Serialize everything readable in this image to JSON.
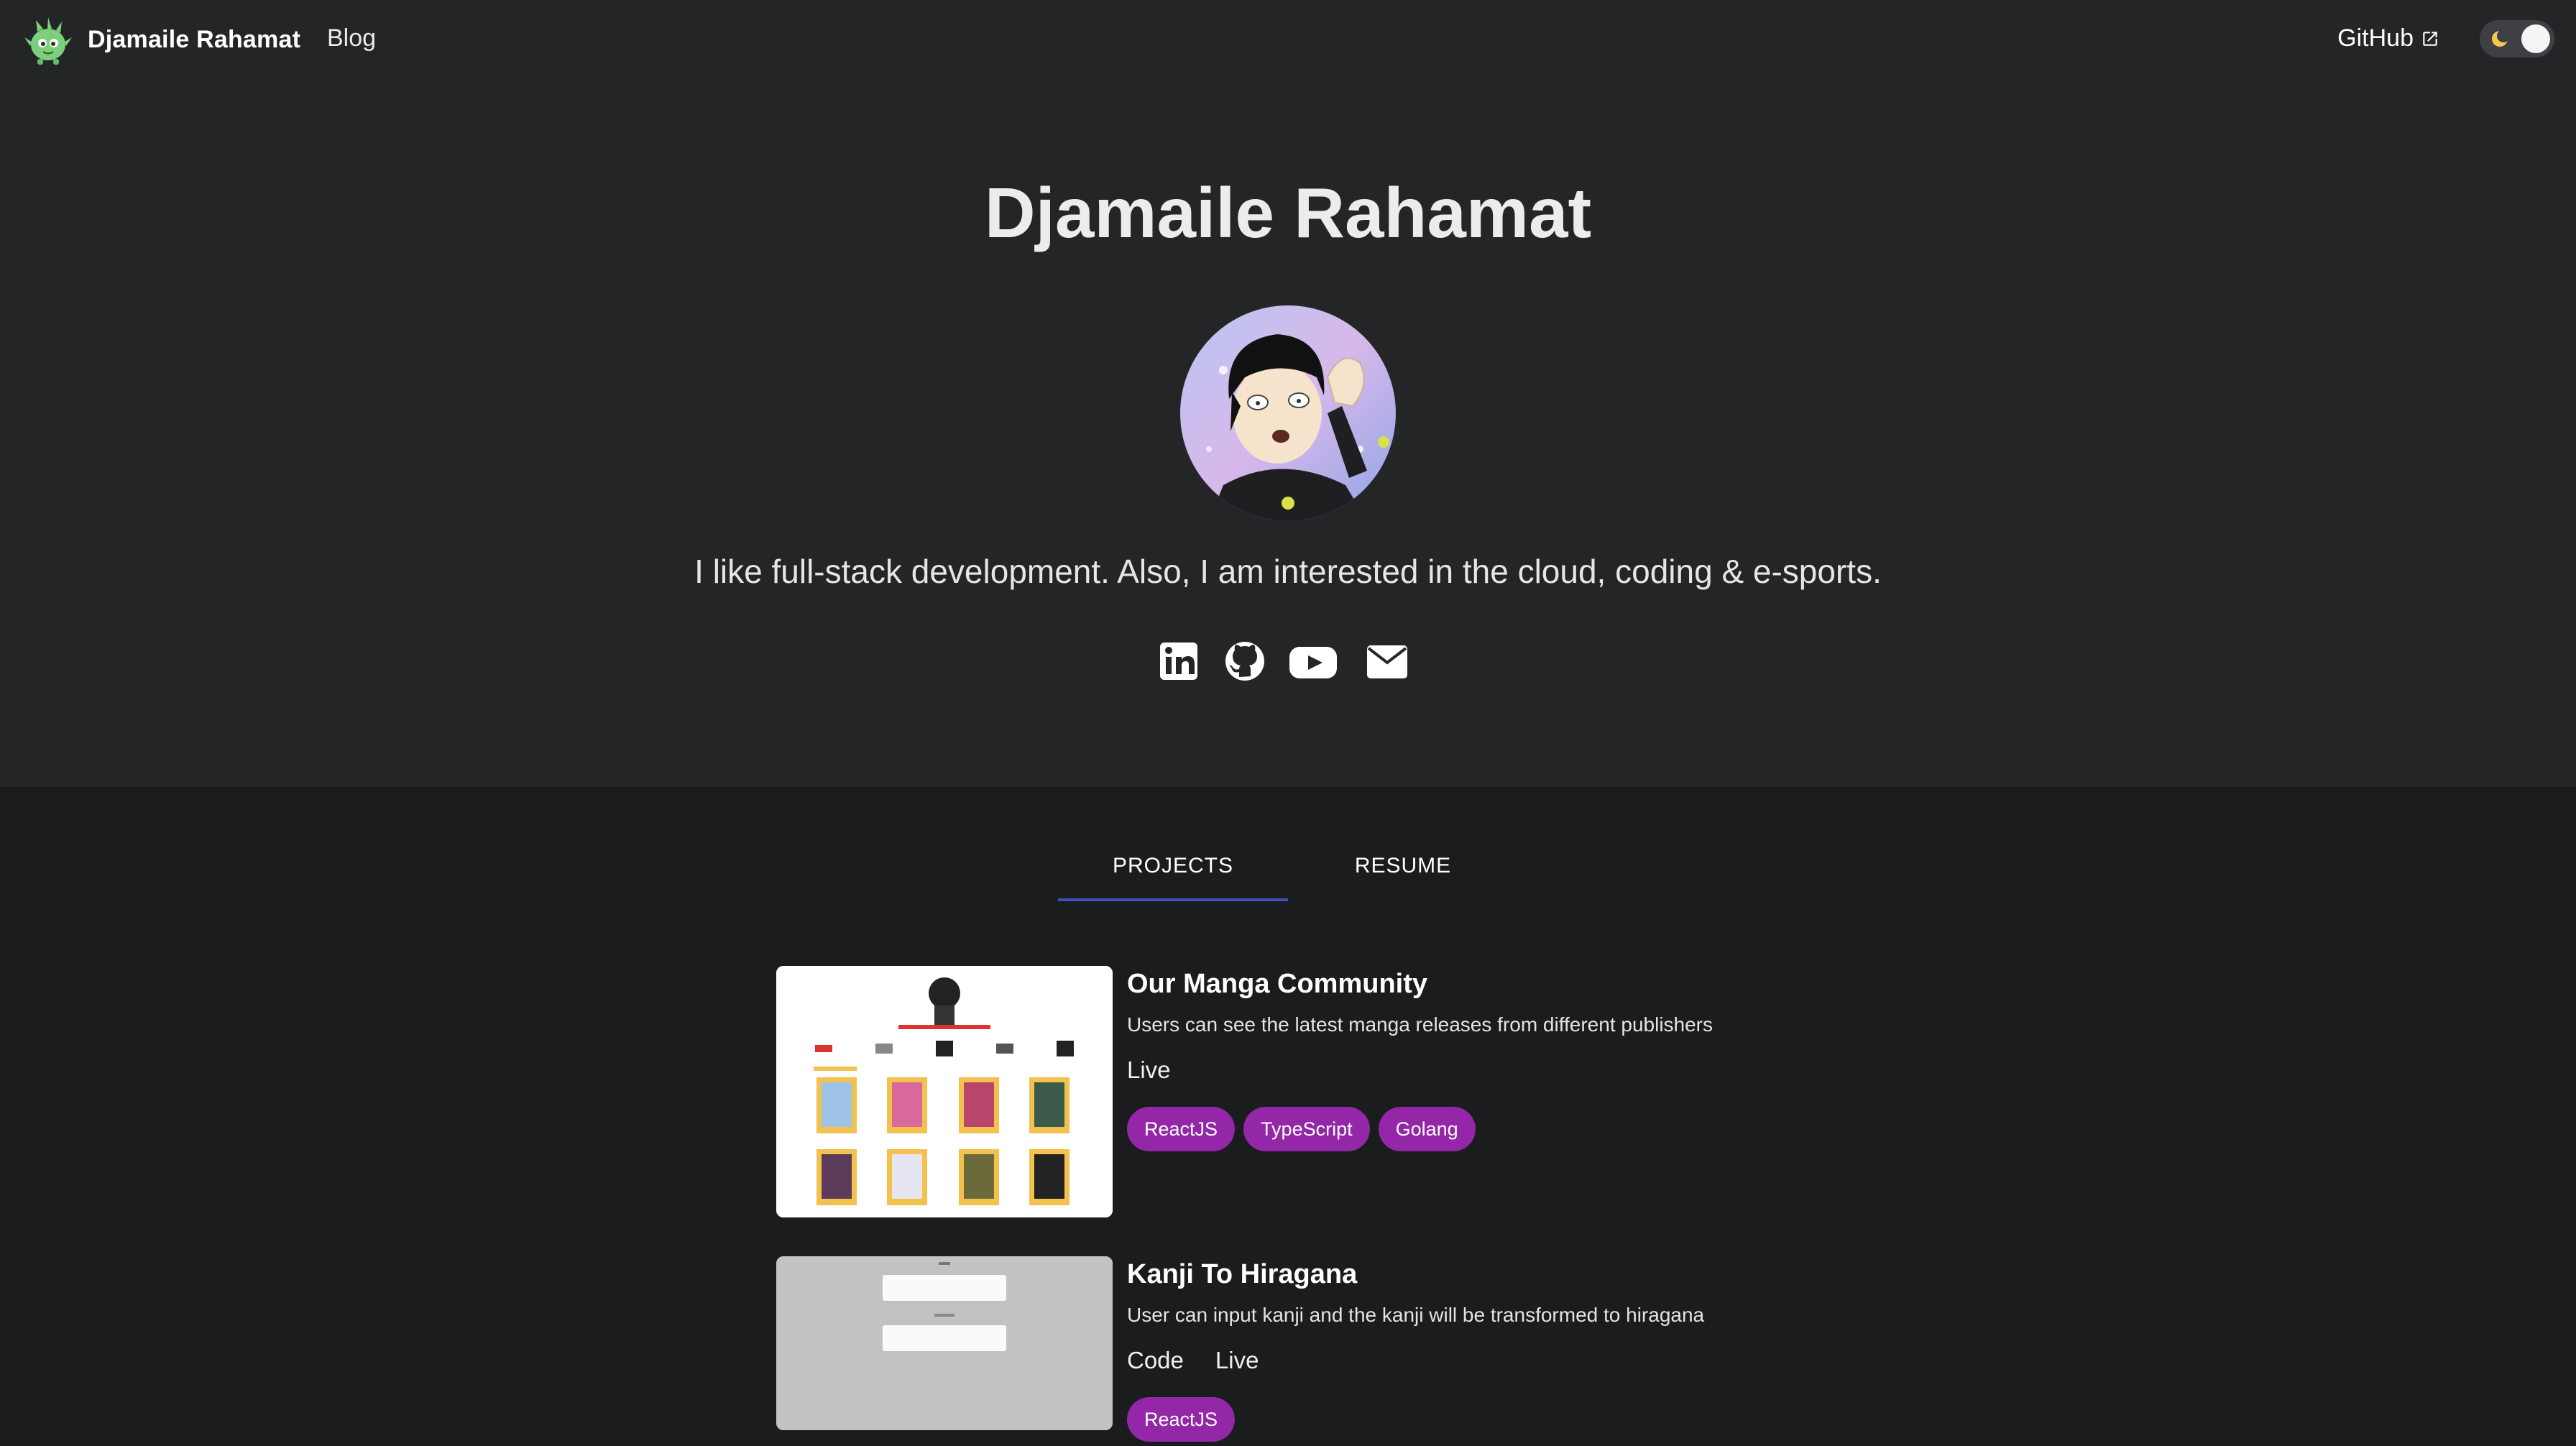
{
  "nav": {
    "brand_name": "Djamaile Rahamat",
    "blog_label": "Blog",
    "github_label": "GitHub"
  },
  "hero": {
    "title": "Djamaile Rahamat",
    "tagline": "I like full-stack development. Also, I am interested in the cloud, coding & e-sports.",
    "socials": [
      "linkedin-icon",
      "github-icon",
      "youtube-icon",
      "email-icon"
    ]
  },
  "tabs": {
    "projects_label": "PROJECTS",
    "resume_label": "RESUME",
    "active": "PROJECTS"
  },
  "projects": [
    {
      "title": "Our Manga Community",
      "description": "Users can see the latest manga releases from different publishers",
      "links": [
        "Live"
      ],
      "tags": [
        "ReactJS",
        "TypeScript",
        "Golang"
      ]
    },
    {
      "title": "Kanji To Hiragana",
      "description": "User can input kanji and the kanji will be transformed to hiragana",
      "links": [
        "Code",
        "Live"
      ],
      "tags": [
        "ReactJS"
      ]
    }
  ],
  "colors": {
    "header_bg": "#242527",
    "page_bg": "#1b1c1e",
    "tab_indicator": "#3f51b5",
    "tag_bg": "#9327a7",
    "logo_green": "#7ccf7c"
  }
}
